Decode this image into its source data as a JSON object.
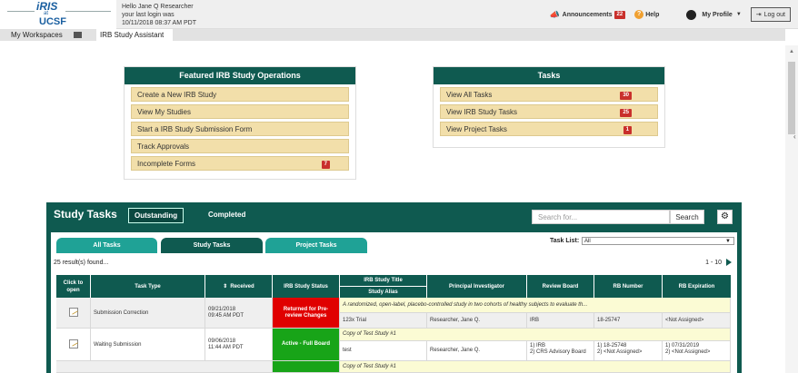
{
  "header": {
    "logo_lines": [
      "iRIS",
      "at",
      "UCSF"
    ],
    "greeting": [
      "Hello Jane Q Researcher",
      "your last login was",
      "10/11/2018 08:37 AM PDT"
    ],
    "announcements_label": "Announcements",
    "announcements_count": "22",
    "help_label": "Help",
    "profile_label": "My Profile",
    "logout_label": "Log out"
  },
  "tabs": {
    "workspaces": "My Workspaces",
    "study_assistant": "IRB Study Assistant"
  },
  "featured": {
    "title": "Featured IRB Study Operations",
    "items": [
      {
        "label": "Create a New IRB Study"
      },
      {
        "label": "View My Studies"
      },
      {
        "label": "Start a IRB Study Submission Form"
      },
      {
        "label": "Track Approvals"
      },
      {
        "label": "Incomplete Forms",
        "badge": "7"
      }
    ]
  },
  "tasks": {
    "title": "Tasks",
    "items": [
      {
        "label": "View All Tasks",
        "badge": "30"
      },
      {
        "label": "View IRB Study Tasks",
        "badge": "25"
      },
      {
        "label": "View Project Tasks",
        "badge": "1"
      }
    ]
  },
  "study_tasks": {
    "title": "Study Tasks",
    "outstanding": "Outstanding",
    "completed": "Completed",
    "search_placeholder": "Search for...",
    "search_button": "Search",
    "subtabs": [
      "All Tasks",
      "Study Tasks",
      "Project Tasks"
    ],
    "task_list_label": "Task List:",
    "task_list_value": "All",
    "results": "25 result(s) found...",
    "pager": "1 - 10",
    "columns": {
      "click": "Click to open",
      "task_type": "Task Type",
      "received": "Received",
      "status": "IRB Study Status",
      "title": "IRB Study Title",
      "alias": "Study Alias",
      "pi": "Principal Investigator",
      "board": "Review Board",
      "irb_number": "RB Number",
      "expiration": "RB Expiration"
    },
    "rows": [
      {
        "task_type": "Submission Correction",
        "received_date": "09/21/2018",
        "received_time": "09:45 AM PDT",
        "status": "Returned for Pre-review Changes",
        "title": "A randomized, open-label, placebo-controlled study in two cohorts of healthy subjects to evaluate th...",
        "alias": "123x Trial",
        "pi": "Researcher, Jane Q.",
        "board": "IRB",
        "irb_number": "18-25747",
        "expiration": "<Not Assigned>"
      },
      {
        "task_type": "Waiting Submission",
        "received_date": "09/06/2018",
        "received_time": "11:44 AM PDT",
        "status": "Active - Full Board",
        "title": "Copy of Test Study #1",
        "alias": "test",
        "pi": "Researcher, Jane Q.",
        "board": [
          "1) IRB",
          "2) CRS Advisory Board"
        ],
        "irb_number": [
          "1) 18-25748",
          "2) <Not Assigned>"
        ],
        "expiration": [
          "1) 07/31/2019",
          "2) <Not Assigned>"
        ]
      },
      {
        "title": "Copy of Test Study #1"
      }
    ]
  },
  "colors": {
    "teal_dark": "#0f5a50",
    "teal_light": "#1fa296",
    "option_bg": "#f2dfaa",
    "badge_red": "#c9302c",
    "status_red": "#e00000",
    "status_green": "#18a418"
  },
  "icons": [
    "megaphone-icon",
    "help-icon",
    "user-icon",
    "logout-icon",
    "gear-icon",
    "document-icon",
    "sort-icon",
    "dropdown-icon"
  ]
}
